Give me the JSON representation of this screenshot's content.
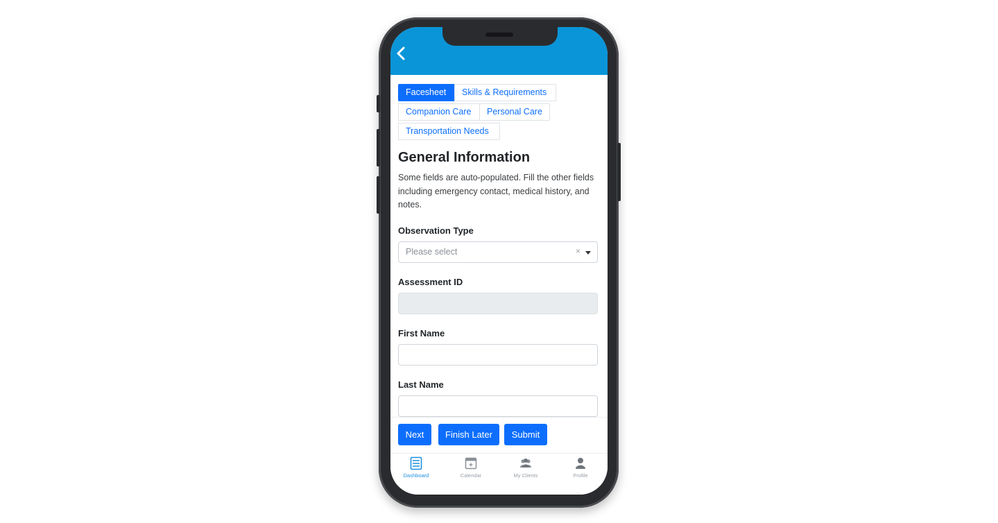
{
  "tabs": [
    {
      "label": "Facesheet",
      "active": true
    },
    {
      "label": "Skills & Requirements",
      "active": false
    },
    {
      "label": "Companion Care",
      "active": false
    },
    {
      "label": "Personal Care",
      "active": false
    },
    {
      "label": "Transportation Needs",
      "active": false
    }
  ],
  "section": {
    "title": "General Information",
    "description": "Some fields are auto-populated. Fill the other fields including emergency contact, medical history, and notes."
  },
  "fields": {
    "observation_type": {
      "label": "Observation Type",
      "placeholder": "Please select",
      "clear": "×"
    },
    "assessment_id": {
      "label": "Assessment ID",
      "value": ""
    },
    "first_name": {
      "label": "First Name",
      "value": ""
    },
    "last_name": {
      "label": "Last Name",
      "value": ""
    }
  },
  "actions": {
    "next": "Next",
    "finish_later": "Finish Later",
    "submit": "Submit"
  },
  "tabbar": [
    {
      "label": "Dashboard",
      "icon": "dashboard-icon",
      "active": true
    },
    {
      "label": "Calendar",
      "icon": "calendar-icon",
      "active": false
    },
    {
      "label": "My Clients",
      "icon": "clients-icon",
      "active": false
    },
    {
      "label": "Profile",
      "icon": "profile-icon",
      "active": false
    }
  ],
  "colors": {
    "header": "#0a95d8",
    "primary": "#0d6efd",
    "tabbar_active": "#1f8fe0",
    "phone_frame": "#2a2b2e"
  }
}
